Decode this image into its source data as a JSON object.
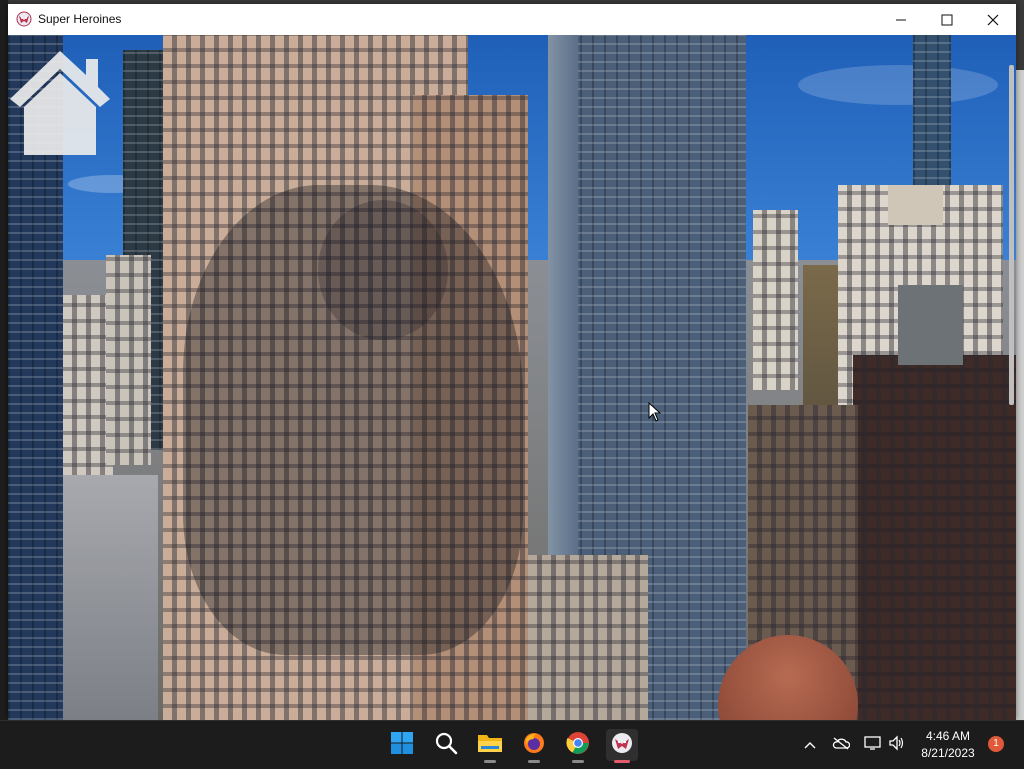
{
  "window": {
    "title": "Super Heroines",
    "minimize_icon": "minimize-icon",
    "maximize_icon": "maximize-icon",
    "close_icon": "close-icon"
  },
  "content": {
    "home_icon": "home-icon",
    "background": "city-skyline-photo"
  },
  "taskbar": {
    "apps": [
      {
        "name": "start-icon",
        "active": false
      },
      {
        "name": "search-icon",
        "active": false
      },
      {
        "name": "file-explorer-icon",
        "active": false
      },
      {
        "name": "firefox-icon",
        "active": false
      },
      {
        "name": "chrome-icon",
        "active": false
      },
      {
        "name": "super-heroines-app-icon",
        "active": true
      }
    ],
    "tray": {
      "chevron": "chevron-up-icon",
      "cloud": "onedrive-icon",
      "network": "network-icon",
      "volume": "volume-icon"
    },
    "time": "4:46 AM",
    "date": "8/21/2023",
    "notification_count": "1"
  },
  "colors": {
    "taskbar_bg": "#1c1c1c",
    "sky_top": "#1f5fb8",
    "chrome_red": "#db4437",
    "notification": "#e05a3a"
  }
}
